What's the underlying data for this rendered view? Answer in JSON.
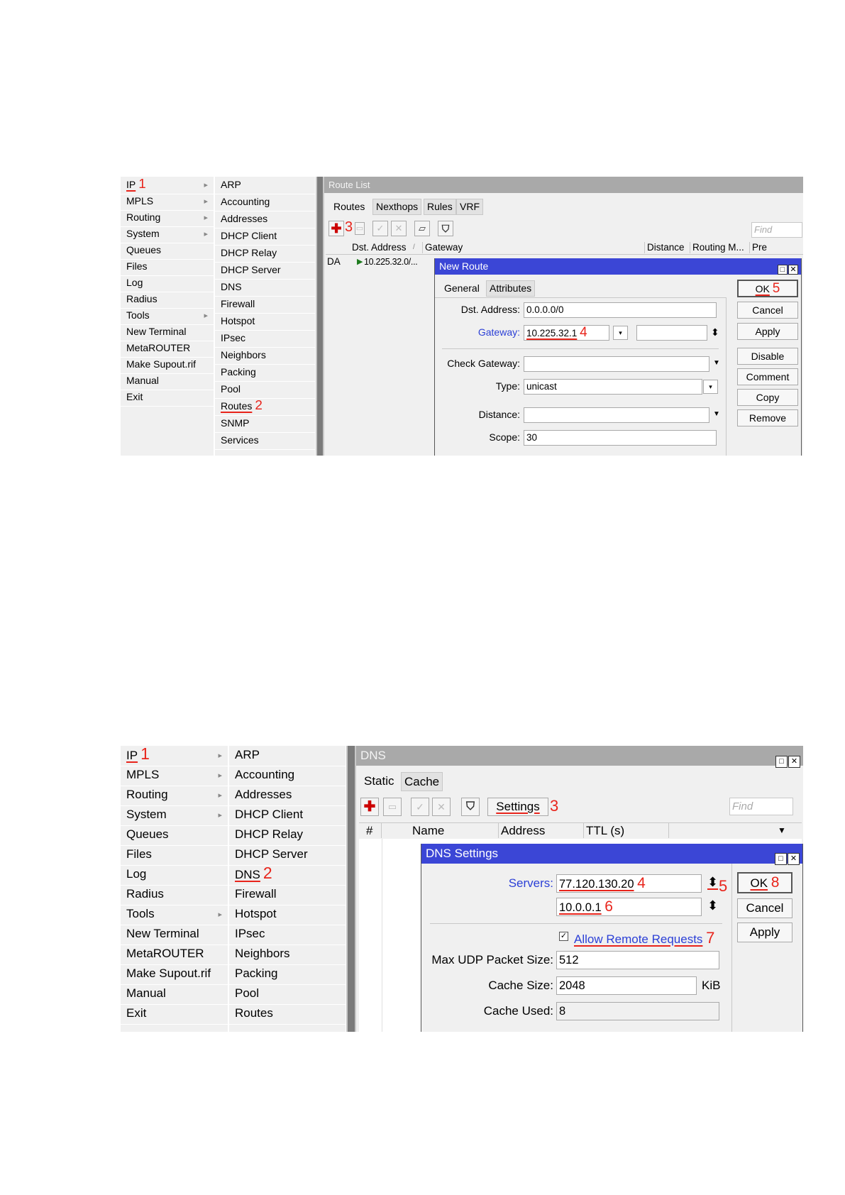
{
  "screenshot1": {
    "menu_main": [
      {
        "label": "IP",
        "num": "1",
        "arrow": true,
        "marked": true
      },
      {
        "label": "MPLS",
        "arrow": true
      },
      {
        "label": "Routing",
        "arrow": true
      },
      {
        "label": "System",
        "arrow": true
      },
      {
        "label": "Queues"
      },
      {
        "label": "Files"
      },
      {
        "label": "Log"
      },
      {
        "label": "Radius"
      },
      {
        "label": "Tools",
        "arrow": true
      },
      {
        "label": "New Terminal"
      },
      {
        "label": "MetaROUTER"
      },
      {
        "label": "Make Supout.rif"
      },
      {
        "label": "Manual"
      },
      {
        "label": "Exit"
      }
    ],
    "menu_sub": [
      {
        "label": "ARP"
      },
      {
        "label": "Accounting"
      },
      {
        "label": "Addresses"
      },
      {
        "label": "DHCP Client"
      },
      {
        "label": "DHCP Relay"
      },
      {
        "label": "DHCP Server"
      },
      {
        "label": "DNS"
      },
      {
        "label": "Firewall"
      },
      {
        "label": "Hotspot"
      },
      {
        "label": "IPsec"
      },
      {
        "label": "Neighbors"
      },
      {
        "label": "Packing"
      },
      {
        "label": "Pool"
      },
      {
        "label": "Routes",
        "num": "2",
        "marked": true
      },
      {
        "label": "SNMP"
      },
      {
        "label": "Services"
      }
    ],
    "route_list": {
      "title": "Route List",
      "tabs": [
        "Routes",
        "Nexthops",
        "Rules",
        "VRF"
      ],
      "add_step": "3",
      "find_placeholder": "Find",
      "columns": [
        "Dst. Address",
        "/",
        "Gateway",
        "Distance",
        "Routing M...",
        "Pre"
      ],
      "row": {
        "flags": "DA",
        "dst": "10.225.32.0/..."
      }
    },
    "new_route": {
      "title": "New Route",
      "tabs": [
        "General",
        "Attributes"
      ],
      "fields": {
        "dst_label": "Dst. Address:",
        "dst_value": "0.0.0.0/0",
        "gateway_label": "Gateway:",
        "gateway_value": "10.225.32.1",
        "gateway_step": "4",
        "check_gateway_label": "Check Gateway:",
        "type_label": "Type:",
        "type_value": "unicast",
        "distance_label": "Distance:",
        "scope_label": "Scope:",
        "scope_value": "30"
      },
      "buttons": [
        "OK",
        "Cancel",
        "Apply",
        "Disable",
        "Comment",
        "Copy",
        "Remove"
      ],
      "ok_step": "5"
    }
  },
  "screenshot2": {
    "menu_main": [
      {
        "label": "IP",
        "num": "1",
        "arrow": true,
        "marked": true
      },
      {
        "label": "MPLS",
        "arrow": true
      },
      {
        "label": "Routing",
        "arrow": true
      },
      {
        "label": "System",
        "arrow": true
      },
      {
        "label": "Queues"
      },
      {
        "label": "Files"
      },
      {
        "label": "Log"
      },
      {
        "label": "Radius"
      },
      {
        "label": "Tools",
        "arrow": true
      },
      {
        "label": "New Terminal"
      },
      {
        "label": "MetaROUTER"
      },
      {
        "label": "Make Supout.rif"
      },
      {
        "label": "Manual"
      },
      {
        "label": "Exit"
      }
    ],
    "menu_sub": [
      {
        "label": "ARP"
      },
      {
        "label": "Accounting"
      },
      {
        "label": "Addresses"
      },
      {
        "label": "DHCP Client"
      },
      {
        "label": "DHCP Relay"
      },
      {
        "label": "DHCP Server"
      },
      {
        "label": "DNS",
        "num": "2",
        "marked": true
      },
      {
        "label": "Firewall"
      },
      {
        "label": "Hotspot"
      },
      {
        "label": "IPsec"
      },
      {
        "label": "Neighbors"
      },
      {
        "label": "Packing"
      },
      {
        "label": "Pool"
      },
      {
        "label": "Routes"
      }
    ],
    "dns": {
      "title": "DNS",
      "tabs": [
        "Static",
        "Cache"
      ],
      "settings_label": "Settings",
      "settings_step": "3",
      "find_placeholder": "Find",
      "columns": [
        "#",
        "Name",
        "Address",
        "TTL (s)"
      ]
    },
    "dns_settings": {
      "title": "DNS Settings",
      "servers_label": "Servers:",
      "server1": "77.120.130.20",
      "server1_step": "4",
      "server2": "10.0.0.1",
      "server2_step": "6",
      "spin_step": "5",
      "allow_remote_label": "Allow Remote Requests",
      "allow_remote_step": "7",
      "max_udp_label": "Max UDP Packet Size:",
      "max_udp_value": "512",
      "cache_size_label": "Cache Size:",
      "cache_size_value": "2048",
      "cache_size_unit": "KiB",
      "cache_used_label": "Cache Used:",
      "cache_used_value": "8",
      "buttons": [
        "OK",
        "Cancel",
        "Apply"
      ],
      "ok_step": "8"
    }
  }
}
